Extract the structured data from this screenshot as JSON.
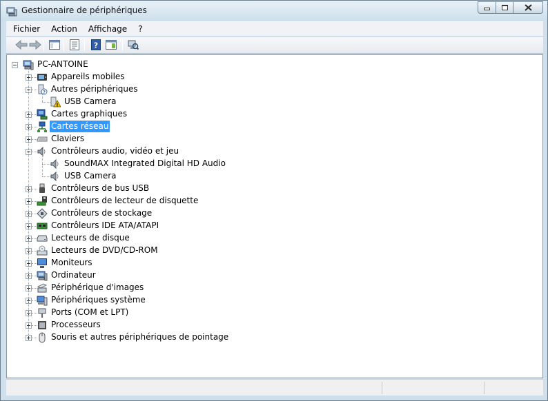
{
  "window": {
    "title": "Gestionnaire de périphériques"
  },
  "menu": [
    "Fichier",
    "Action",
    "Affichage",
    "?"
  ],
  "toolbar": [
    "back-icon",
    "forward-icon",
    "show-hide-console-tree-icon",
    "properties-icon",
    "help-icon",
    "view-icon",
    "scan-hardware-icon"
  ],
  "tree": {
    "root": "PC-ANTOINE",
    "nodes": [
      {
        "label": "Appareils mobiles",
        "icon": "mobile-device-icon",
        "expanded": false,
        "children": []
      },
      {
        "label": "Autres périphériques",
        "icon": "unknown-device-icon",
        "expanded": true,
        "children": [
          {
            "label": "USB Camera",
            "icon": "warning-device-icon"
          }
        ]
      },
      {
        "label": "Cartes graphiques",
        "icon": "display-adapter-icon",
        "expanded": false,
        "children": []
      },
      {
        "label": "Cartes réseau",
        "icon": "network-adapter-icon",
        "expanded": false,
        "selected": true,
        "children": []
      },
      {
        "label": "Claviers",
        "icon": "keyboard-icon",
        "expanded": false,
        "children": []
      },
      {
        "label": "Contrôleurs audio, vidéo et jeu",
        "icon": "speaker-icon",
        "expanded": true,
        "children": [
          {
            "label": "SoundMAX Integrated Digital HD Audio",
            "icon": "speaker-icon"
          },
          {
            "label": "USB Camera",
            "icon": "speaker-icon"
          }
        ]
      },
      {
        "label": "Contrôleurs de bus USB",
        "icon": "usb-icon",
        "expanded": false,
        "children": []
      },
      {
        "label": "Contrôleurs de lecteur de disquette",
        "icon": "floppy-controller-icon",
        "expanded": false,
        "children": []
      },
      {
        "label": "Contrôleurs de stockage",
        "icon": "storage-controller-icon",
        "expanded": false,
        "children": []
      },
      {
        "label": "Contrôleurs IDE ATA/ATAPI",
        "icon": "ide-controller-icon",
        "expanded": false,
        "children": []
      },
      {
        "label": "Lecteurs de disque",
        "icon": "disk-drive-icon",
        "expanded": false,
        "children": []
      },
      {
        "label": "Lecteurs de DVD/CD-ROM",
        "icon": "dvd-drive-icon",
        "expanded": false,
        "children": []
      },
      {
        "label": "Moniteurs",
        "icon": "monitor-icon",
        "expanded": false,
        "children": []
      },
      {
        "label": "Ordinateur",
        "icon": "computer-icon",
        "expanded": false,
        "children": []
      },
      {
        "label": "Périphérique d'images",
        "icon": "imaging-device-icon",
        "expanded": false,
        "children": []
      },
      {
        "label": "Périphériques système",
        "icon": "system-device-icon",
        "expanded": false,
        "children": []
      },
      {
        "label": "Ports (COM et LPT)",
        "icon": "port-icon",
        "expanded": false,
        "children": []
      },
      {
        "label": "Processeurs",
        "icon": "processor-icon",
        "expanded": false,
        "children": []
      },
      {
        "label": "Souris et autres périphériques de pointage",
        "icon": "mouse-icon",
        "expanded": false,
        "children": []
      }
    ]
  },
  "colors": {
    "selection": "#3399ff",
    "window_frame": "#cfe0ec"
  }
}
